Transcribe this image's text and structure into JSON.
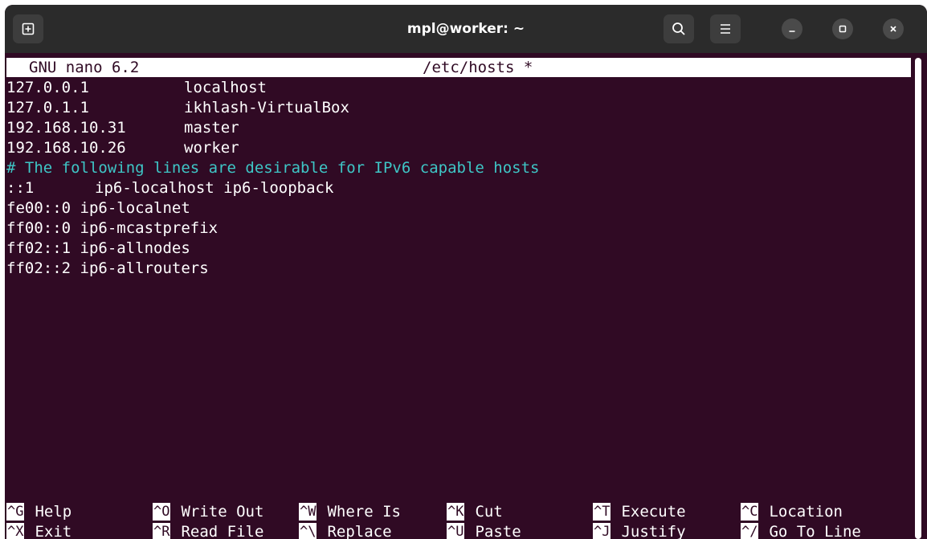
{
  "window": {
    "title": "mpl@worker: ~"
  },
  "nano": {
    "app": "GNU nano 6.2",
    "file": "/etc/hosts *",
    "lines": [
      {
        "addr": "127.0.0.1",
        "host": "localhost"
      },
      {
        "addr": "127.0.1.1",
        "host": "ikhlash-VirtualBox"
      },
      {
        "addr": "192.168.10.31",
        "host": "master"
      },
      {
        "addr": "192.168.10.26",
        "host": "worker"
      }
    ],
    "comment": "# The following lines are desirable for IPv6 capable hosts",
    "ipv6_first": {
      "addr": "::1",
      "host": "ip6-localhost ip6-loopback"
    },
    "ipv6_lines": [
      "fe00::0 ip6-localnet",
      "ff00::0 ip6-mcastprefix",
      "ff02::1 ip6-allnodes",
      "ff02::2 ip6-allrouters"
    ],
    "shortcuts": {
      "help": {
        "key": "^G",
        "label": "Help"
      },
      "exit": {
        "key": "^X",
        "label": "Exit"
      },
      "write_out": {
        "key": "^O",
        "label": "Write Out"
      },
      "read_file": {
        "key": "^R",
        "label": "Read File"
      },
      "where_is": {
        "key": "^W",
        "label": "Where Is"
      },
      "replace": {
        "key": "^\\",
        "label": "Replace"
      },
      "cut": {
        "key": "^K",
        "label": "Cut"
      },
      "paste": {
        "key": "^U",
        "label": "Paste"
      },
      "execute": {
        "key": "^T",
        "label": "Execute"
      },
      "justify": {
        "key": "^J",
        "label": "Justify"
      },
      "location": {
        "key": "^C",
        "label": "Location"
      },
      "go_to_line": {
        "key": "^/",
        "label": "Go To Line"
      }
    }
  },
  "colors": {
    "terminal_bg": "#300a24",
    "titlebar_bg": "#2b2b2b",
    "comment": "#3ec6c6",
    "text": "#ffffff"
  },
  "icons": {
    "new_tab": "new-tab-icon",
    "search": "search-icon",
    "menu": "hamburger-menu-icon",
    "minimize": "minimize-icon",
    "maximize": "maximize-icon",
    "close": "close-icon"
  }
}
